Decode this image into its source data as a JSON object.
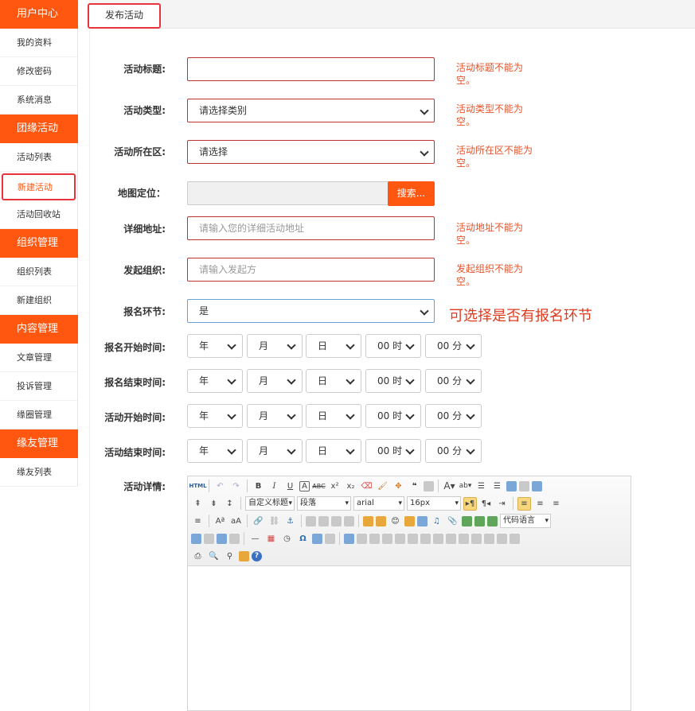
{
  "sidebar": {
    "groups": [
      {
        "title": "用户中心",
        "items": [
          "我的资料",
          "修改密码",
          "系统消息"
        ]
      },
      {
        "title": "团缘活动",
        "items": [
          "活动列表",
          "新建活动",
          "活动回收站"
        ]
      },
      {
        "title": "组织管理",
        "items": [
          "组织列表",
          "新建组织"
        ]
      },
      {
        "title": "内容管理",
        "items": [
          "文章管理",
          "投诉管理",
          "缘圈管理"
        ]
      },
      {
        "title": "缘友管理",
        "items": [
          "缘友列表"
        ]
      }
    ]
  },
  "tabs": {
    "active": "发布活动"
  },
  "form": {
    "title_label": "活动标题:",
    "title_error": "活动标题不能为空。",
    "type_label": "活动类型:",
    "type_value": "请选择类别",
    "type_error": "活动类型不能为空。",
    "district_label": "活动所在区:",
    "district_value": "请选择",
    "district_error": "活动所在区不能为空。",
    "map_label": "地图定位：",
    "map_search_button": "搜索...",
    "address_label": "详细地址:",
    "address_placeholder": "请输入您的详细活动地址",
    "address_error": "活动地址不能为空。",
    "organizer_label": "发起组织:",
    "organizer_placeholder": "请输入发起方",
    "organizer_error": "发起组织不能为空。",
    "signup_label": "报名环节:",
    "signup_value": "是",
    "signup_hint": "可选择是否有报名环节",
    "time_rows": [
      {
        "label": "报名开始时间:"
      },
      {
        "label": "报名结束时间:"
      },
      {
        "label": "活动开始时间:"
      },
      {
        "label": "活动结束时间:"
      }
    ],
    "time_selects": {
      "year": "年",
      "month": "月",
      "day": "日",
      "hour": "00 时",
      "minute": "00 分"
    },
    "detail_label": "活动详情:"
  },
  "editor": {
    "style_combo": "自定义标题",
    "paragraph_combo": "段落",
    "font_combo": "arial",
    "size_combo": "16px",
    "code_combo": "代码语言"
  },
  "colors": {
    "accent": "#ff5710",
    "error": "#e4542a",
    "highlight_border": "#e8343d"
  }
}
